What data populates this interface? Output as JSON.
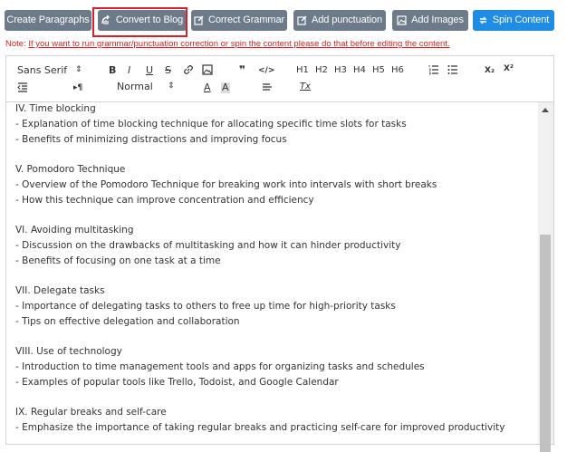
{
  "toolbar": {
    "create_paragraphs": "Create Paragraphs",
    "convert_to_blog": "Convert to Blog",
    "correct_grammar": "Correct Grammar",
    "add_punctuation": "Add punctuation",
    "add_images": "Add Images",
    "spin_content": "Spin Content",
    "grey_color": "#6c7a89",
    "blue_color": "#1f8ce6",
    "highlight_color": "#d8202a"
  },
  "note": {
    "prefix": "Note: ",
    "text": "If you want to run grammar/punctuation correction or spin the content please do that before editing the content."
  },
  "editor_toolbar": {
    "font": "Sans Serif",
    "size": "Normal",
    "bold": "B",
    "italic": "I",
    "underline": "U",
    "strike": "S",
    "quote": "❞",
    "code": "</>",
    "h1": "H1",
    "h2": "H2",
    "h3": "H3",
    "h4": "H4",
    "h5": "H5",
    "h6": "H6",
    "sub": "X₂",
    "sup": "X²",
    "color": "A",
    "background": "A",
    "clean": "Tx",
    "rtl": "▸¶"
  },
  "content": [
    "IV. Time blocking",
    "- Explanation of time blocking technique for allocating specific time slots for tasks",
    "- Benefits of minimizing distractions and improving focus",
    "",
    "V. Pomodoro Technique",
    "- Overview of the Pomodoro Technique for breaking work into intervals with short breaks",
    "- How this technique can improve concentration and efficiency",
    "",
    "VI. Avoiding multitasking",
    "- Discussion on the drawbacks of multitasking and how it can hinder productivity",
    "- Benefits of focusing on one task at a time",
    "",
    "VII. Delegate tasks",
    "- Importance of delegating tasks to others to free up time for high-priority tasks",
    "- Tips on effective delegation and collaboration",
    "",
    "VIII. Use of technology",
    "- Introduction to time management tools and apps for organizing tasks and schedules",
    "- Examples of popular tools like Trello, Todoist, and Google Calendar",
    "",
    "IX. Regular breaks and self-care",
    "- Emphasize the importance of taking regular breaks and practicing self-care for improved productivity"
  ]
}
